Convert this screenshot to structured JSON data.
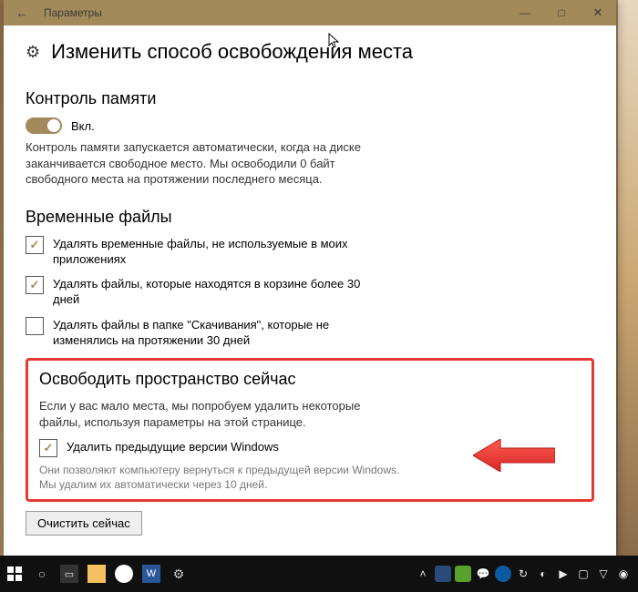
{
  "window": {
    "title": "Параметры",
    "back_icon": "←",
    "min_icon": "—",
    "max_icon": "□",
    "close_icon": "✕"
  },
  "page": {
    "gear_icon": "⚙",
    "title": "Изменить способ освобождения места"
  },
  "memory_control": {
    "heading": "Контроль памяти",
    "toggle_label": "Вкл.",
    "toggle_on": true,
    "description": "Контроль памяти запускается автоматически, когда на диске заканчивается свободное место. Мы освободили 0 байт свободного места на протяжении последнего месяца."
  },
  "temp_files": {
    "heading": "Временные файлы",
    "items": [
      {
        "label": "Удалять временные файлы, не используемые в моих приложениях",
        "checked": true
      },
      {
        "label": "Удалять файлы, которые находятся в корзине более 30 дней",
        "checked": true
      },
      {
        "label": "Удалять файлы в папке \"Скачивания\", которые не изменялись на протяжении 30 дней",
        "checked": false
      }
    ]
  },
  "free_now": {
    "heading": "Освободить пространство сейчас",
    "description": "Если у вас мало места, мы попробуем удалить некоторые файлы, используя параметры на этой странице.",
    "checkbox_label": "Удалить предыдущие версии Windows",
    "checkbox_checked": true,
    "note": "Они позволяют компьютеру вернуться к предыдущей версии Windows. Мы удалим их автоматически через 10 дней.",
    "button_label": "Очистить сейчас"
  },
  "taskbar": {
    "left": [
      "start",
      "search",
      "taskview",
      "explorer",
      "chrome",
      "word",
      "settings"
    ],
    "right": [
      "up",
      "ps",
      "jd",
      "msg",
      "edge",
      "sync",
      "sound",
      "speaker",
      "vol",
      "bt",
      "ru"
    ]
  }
}
